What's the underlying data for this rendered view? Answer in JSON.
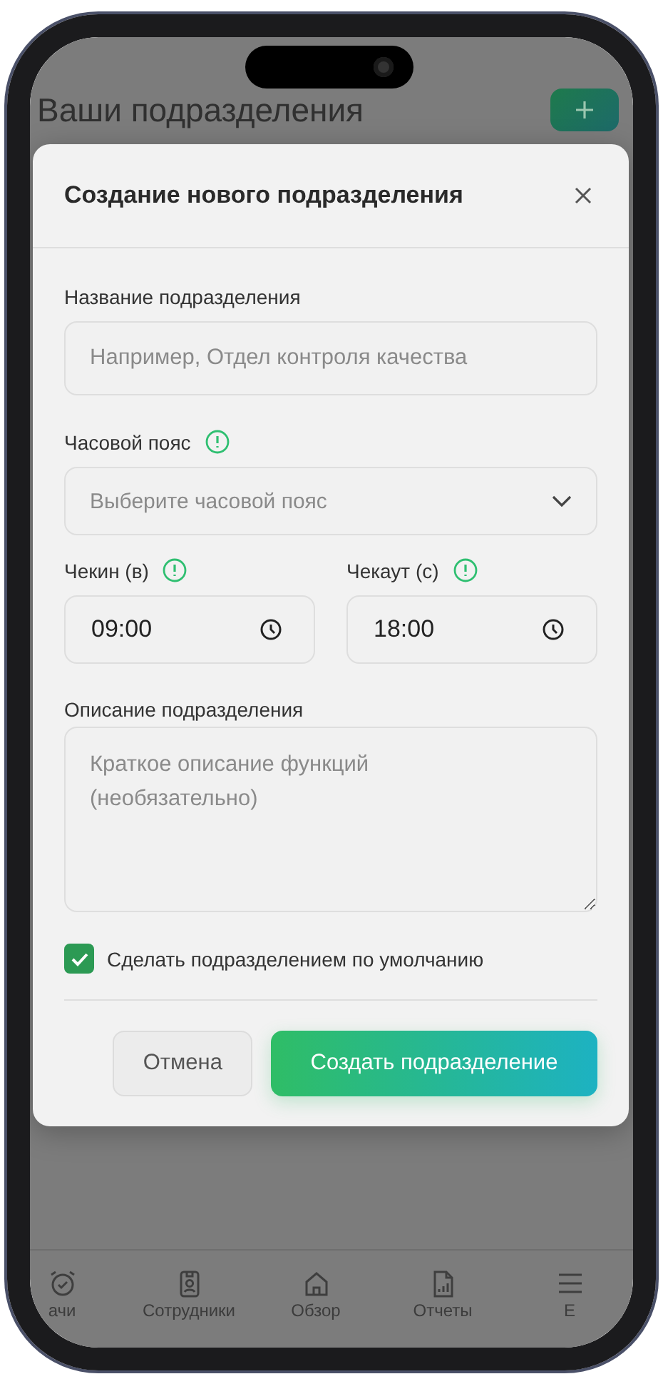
{
  "page": {
    "title": "Ваши подразделения"
  },
  "modal": {
    "title": "Создание нового подразделения",
    "fields": [
      {
        "kind": "text",
        "label": "Название подразделения",
        "info": false,
        "placeholder": "Например, Отдел контроля качества"
      },
      {
        "kind": "select",
        "label": "Часовой пояс",
        "info": true,
        "placeholder": "Выберите часовой пояс"
      },
      {
        "kind": "time_pair",
        "items": [
          {
            "label": "Чекин (в)",
            "info": true,
            "value": "09:00"
          },
          {
            "label": "Чекаут (с)",
            "info": true,
            "value": "18:00"
          }
        ]
      },
      {
        "kind": "textarea",
        "label": "Описание подразделения",
        "info": false,
        "placeholder": "Краткое описание функций\n(необязательно)"
      }
    ],
    "checkbox": {
      "label": "Сделать подразделением по умолчанию",
      "checked": true
    },
    "buttons": [
      {
        "kind": "secondary",
        "label": "Отмена"
      },
      {
        "kind": "primary",
        "label": "Создать подразделение"
      }
    ]
  },
  "nav": [
    {
      "label": "ачи"
    },
    {
      "label": "Сотрудники"
    },
    {
      "label": "Обзор"
    },
    {
      "label": "Отчеты"
    },
    {
      "label": "Е"
    }
  ]
}
